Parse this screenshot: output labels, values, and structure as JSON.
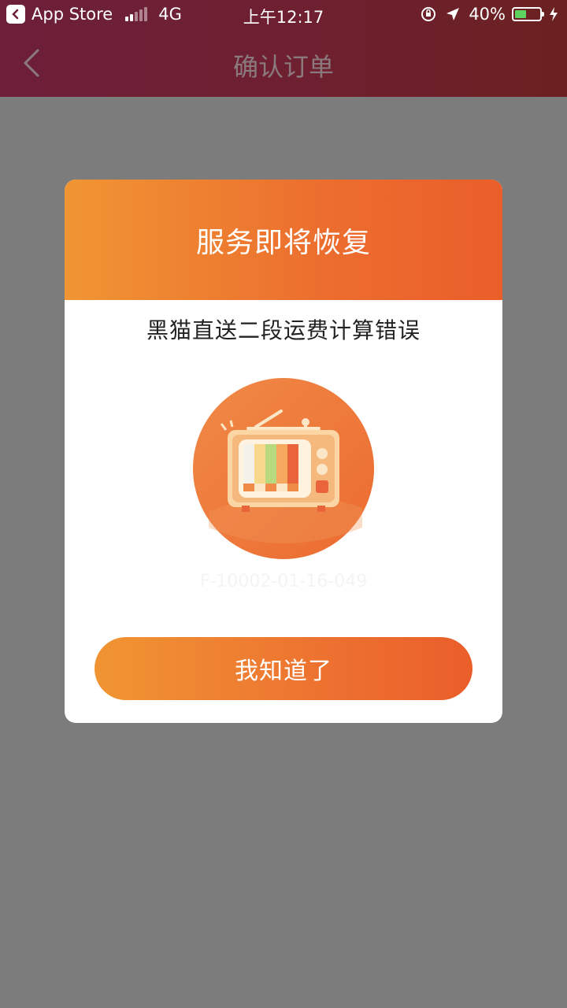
{
  "status_bar": {
    "back_app_label": "App Store",
    "network": "4G",
    "time": "上午12:17",
    "battery_percent": "40%",
    "battery_level": 0.4
  },
  "header": {
    "title": "确认订单",
    "back_icon": "chevron-left-icon"
  },
  "dialog": {
    "title": "服务即将恢复",
    "message": "黑猫直送二段运费计算错误",
    "illustration_icon": "retro-tv-icon",
    "error_code": "F-10002-01-16-049",
    "button_label": "我知道了",
    "accent_start": "#f09533",
    "accent_end": "#ea5e2a"
  }
}
